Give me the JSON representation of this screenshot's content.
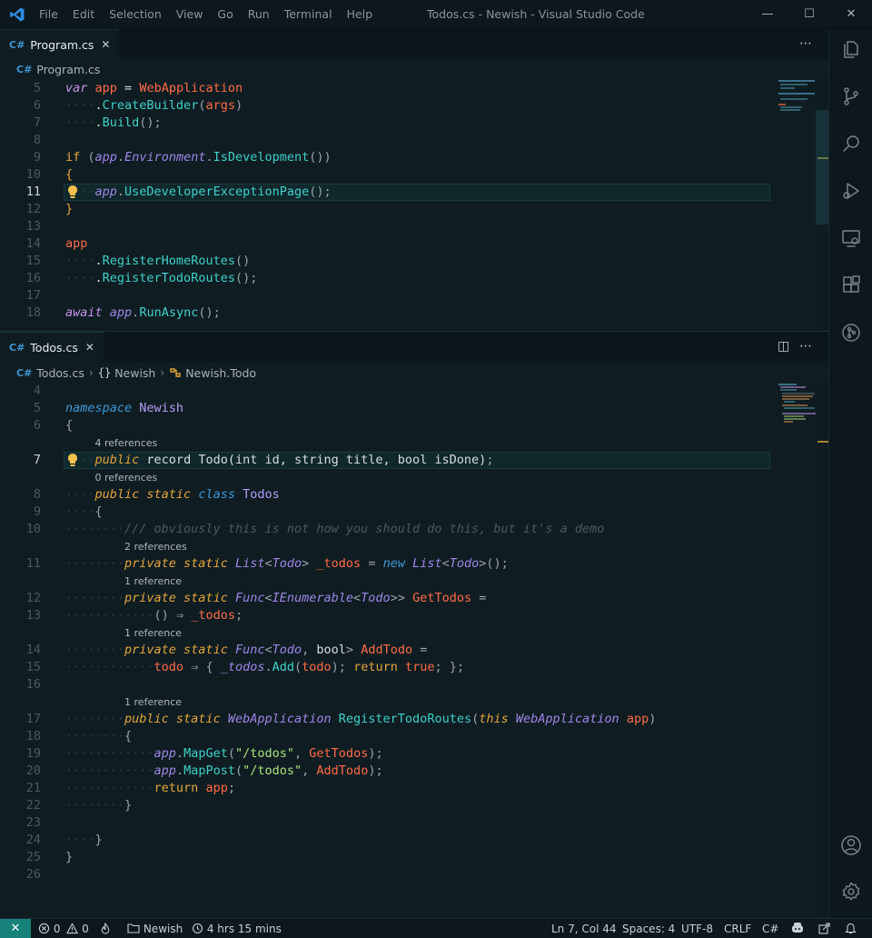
{
  "window": {
    "title": "Todos.cs - Newish - Visual Studio Code",
    "menu": [
      "File",
      "Edit",
      "Selection",
      "View",
      "Go",
      "Run",
      "Terminal",
      "Help"
    ]
  },
  "window_controls": {
    "minimize": "—",
    "maximize": "☐",
    "close": "✕"
  },
  "top_editor": {
    "tab_label": "Program.cs",
    "tab_lang_badge": "C#",
    "close_glyph": "✕",
    "more_actions_glyph": "⋯",
    "breadcrumb_file": "Program.cs",
    "active_line": 11,
    "code_lens": [],
    "lines": [
      {
        "n": "5",
        "seg": [
          [
            "var",
            "k"
          ],
          [
            " ",
            "pl"
          ],
          [
            "app",
            "v"
          ],
          [
            " = ",
            "pl"
          ],
          [
            "WebApplication",
            "v"
          ]
        ]
      },
      {
        "n": "6",
        "seg": [
          [
            "····",
            "ws"
          ],
          [
            ".",
            "pl"
          ],
          [
            "CreateBuilder",
            "m"
          ],
          [
            "(",
            "p"
          ],
          [
            "args",
            "v"
          ],
          [
            ")",
            "p"
          ]
        ]
      },
      {
        "n": "7",
        "seg": [
          [
            "····",
            "ws"
          ],
          [
            ".",
            "pl"
          ],
          [
            "Build",
            "m"
          ],
          [
            "();",
            "p"
          ]
        ]
      },
      {
        "n": "8",
        "seg": []
      },
      {
        "n": "9",
        "seg": [
          [
            "if",
            "ob"
          ],
          [
            " (",
            "p"
          ],
          [
            "app",
            "t"
          ],
          [
            ".",
            "p"
          ],
          [
            "Environment",
            "t"
          ],
          [
            ".",
            "p"
          ],
          [
            "IsDevelopment",
            "m"
          ],
          [
            "())",
            "p"
          ]
        ]
      },
      {
        "n": "10",
        "seg": [
          [
            "{",
            "ob"
          ]
        ]
      },
      {
        "n": "11",
        "seg": [
          [
            "····",
            "ws"
          ],
          [
            "app",
            "t"
          ],
          [
            ".",
            "p"
          ],
          [
            "UseDeveloperExceptionPage",
            "m"
          ],
          [
            "();",
            "p"
          ]
        ]
      },
      {
        "n": "12",
        "seg": [
          [
            "}",
            "ob"
          ]
        ]
      },
      {
        "n": "13",
        "seg": []
      },
      {
        "n": "14",
        "seg": [
          [
            "app",
            "v"
          ]
        ]
      },
      {
        "n": "15",
        "seg": [
          [
            "····",
            "ws"
          ],
          [
            ".",
            "pl"
          ],
          [
            "RegisterHomeRoutes",
            "m"
          ],
          [
            "()",
            "p"
          ]
        ]
      },
      {
        "n": "16",
        "seg": [
          [
            "····",
            "ws"
          ],
          [
            ".",
            "pl"
          ],
          [
            "RegisterTodoRoutes",
            "m"
          ],
          [
            "();",
            "p"
          ]
        ]
      },
      {
        "n": "17",
        "seg": []
      },
      {
        "n": "18",
        "seg": [
          [
            "await",
            "k"
          ],
          [
            " ",
            "pl"
          ],
          [
            "app",
            "t"
          ],
          [
            ".",
            "p"
          ],
          [
            "RunAsync",
            "m"
          ],
          [
            "();",
            "p"
          ]
        ]
      }
    ]
  },
  "bottom_editor": {
    "tab_label": "Todos.cs",
    "tab_lang_badge": "C#",
    "close_glyph": "✕",
    "split_glyph": "◫",
    "more_actions_glyph": "⋯",
    "breadcrumb": [
      "Todos.cs",
      "Newish",
      "Newish.Todo"
    ],
    "breadcrumb_separator": "›",
    "breadcrumb_namespace_glyph": "{}",
    "active_line": 7,
    "code_lens": [
      {
        "before_line": "7",
        "label": "4 references"
      },
      {
        "before_line": "8",
        "label": "0 references"
      },
      {
        "before_line": "11",
        "label": "2 references"
      },
      {
        "before_line": "12",
        "label": "1 reference"
      },
      {
        "before_line": "14",
        "label": "1 reference"
      },
      {
        "before_line": "17",
        "label": "1 reference"
      }
    ],
    "lines": [
      {
        "n": "4",
        "seg": []
      },
      {
        "n": "5",
        "seg": [
          [
            "namespace",
            "kb"
          ],
          [
            " ",
            "pl"
          ],
          [
            "Newish",
            "cls"
          ]
        ]
      },
      {
        "n": "6",
        "seg": [
          [
            "{",
            "p"
          ]
        ]
      },
      {
        "n": "7",
        "seg": [
          [
            "····",
            "ws"
          ],
          [
            "public",
            "kw"
          ],
          [
            " record ",
            "pl"
          ],
          [
            "Todo",
            "pl"
          ],
          [
            "(int id, string title, bool isDone)",
            "pl"
          ],
          [
            ";",
            "p"
          ]
        ]
      },
      {
        "n": "8",
        "seg": [
          [
            "····",
            "ws"
          ],
          [
            "public static",
            "kw"
          ],
          [
            " ",
            "pl"
          ],
          [
            "class",
            "kb"
          ],
          [
            " ",
            "pl"
          ],
          [
            "Todos",
            "cls"
          ]
        ]
      },
      {
        "n": "9",
        "seg": [
          [
            "····",
            "ws"
          ],
          [
            "{",
            "p"
          ]
        ]
      },
      {
        "n": "10",
        "seg": [
          [
            "········",
            "ws"
          ],
          [
            "/// obviously this is not how you should do this, but it's a demo",
            "cm"
          ]
        ]
      },
      {
        "n": "11",
        "seg": [
          [
            "········",
            "ws"
          ],
          [
            "private static",
            "kw"
          ],
          [
            " ",
            "pl"
          ],
          [
            "List",
            "t"
          ],
          [
            "<",
            "p"
          ],
          [
            "Todo",
            "t"
          ],
          [
            "> ",
            "p"
          ],
          [
            "_todos",
            "v"
          ],
          [
            " = ",
            "p"
          ],
          [
            "new",
            "kb"
          ],
          [
            " ",
            "pl"
          ],
          [
            "List",
            "t"
          ],
          [
            "<",
            "p"
          ],
          [
            "Todo",
            "t"
          ],
          [
            ">();",
            "p"
          ]
        ]
      },
      {
        "n": "12",
        "seg": [
          [
            "········",
            "ws"
          ],
          [
            "private static",
            "kw"
          ],
          [
            " ",
            "pl"
          ],
          [
            "Func",
            "t"
          ],
          [
            "<",
            "p"
          ],
          [
            "IEnumerable",
            "t"
          ],
          [
            "<",
            "p"
          ],
          [
            "Todo",
            "t"
          ],
          [
            ">> ",
            "p"
          ],
          [
            "GetTodos",
            "v"
          ],
          [
            " =",
            "p"
          ]
        ]
      },
      {
        "n": "13",
        "seg": [
          [
            "············",
            "ws"
          ],
          [
            "() ",
            "p"
          ],
          [
            "⇒",
            "p"
          ],
          [
            " ",
            "pl"
          ],
          [
            "_todos",
            "v"
          ],
          [
            ";",
            "p"
          ]
        ]
      },
      {
        "n": "14",
        "seg": [
          [
            "········",
            "ws"
          ],
          [
            "private static",
            "kw"
          ],
          [
            " ",
            "pl"
          ],
          [
            "Func",
            "t"
          ],
          [
            "<",
            "p"
          ],
          [
            "Todo",
            "t"
          ],
          [
            ", ",
            "p"
          ],
          [
            "bool",
            "pl"
          ],
          [
            "> ",
            "p"
          ],
          [
            "AddTodo",
            "v"
          ],
          [
            " =",
            "p"
          ]
        ]
      },
      {
        "n": "15",
        "seg": [
          [
            "············",
            "ws"
          ],
          [
            "todo",
            "v"
          ],
          [
            " ⇒ { ",
            "p"
          ],
          [
            "_todos",
            "t"
          ],
          [
            ".",
            "p"
          ],
          [
            "Add",
            "m"
          ],
          [
            "(",
            "p"
          ],
          [
            "todo",
            "v"
          ],
          [
            ");",
            "p"
          ],
          [
            " return ",
            "ob"
          ],
          [
            "true",
            "v"
          ],
          [
            ";",
            "p"
          ],
          [
            " };",
            "p"
          ]
        ]
      },
      {
        "n": "16",
        "seg": []
      },
      {
        "n": "17",
        "seg": [
          [
            "········",
            "ws"
          ],
          [
            "public static",
            "kw"
          ],
          [
            " ",
            "pl"
          ],
          [
            "WebApplication",
            "t"
          ],
          [
            " ",
            "pl"
          ],
          [
            "RegisterTodoRoutes",
            "m"
          ],
          [
            "(",
            "p"
          ],
          [
            "this",
            "kw"
          ],
          [
            " ",
            "pl"
          ],
          [
            "WebApplication",
            "t"
          ],
          [
            " ",
            "pl"
          ],
          [
            "app",
            "v"
          ],
          [
            ")",
            "p"
          ]
        ]
      },
      {
        "n": "18",
        "seg": [
          [
            "········",
            "ws"
          ],
          [
            "{",
            "p"
          ]
        ]
      },
      {
        "n": "19",
        "seg": [
          [
            "············",
            "ws"
          ],
          [
            "app",
            "t"
          ],
          [
            ".",
            "p"
          ],
          [
            "MapGet",
            "m"
          ],
          [
            "(",
            "p"
          ],
          [
            "\"/todos\"",
            "s"
          ],
          [
            ", ",
            "p"
          ],
          [
            "GetTodos",
            "v"
          ],
          [
            ");",
            "p"
          ]
        ]
      },
      {
        "n": "20",
        "seg": [
          [
            "············",
            "ws"
          ],
          [
            "app",
            "t"
          ],
          [
            ".",
            "p"
          ],
          [
            "MapPost",
            "m"
          ],
          [
            "(",
            "p"
          ],
          [
            "\"/todos\"",
            "s"
          ],
          [
            ", ",
            "p"
          ],
          [
            "AddTodo",
            "v"
          ],
          [
            ");",
            "p"
          ]
        ]
      },
      {
        "n": "21",
        "seg": [
          [
            "············",
            "ws"
          ],
          [
            "return",
            "ob"
          ],
          [
            " ",
            "pl"
          ],
          [
            "app",
            "v"
          ],
          [
            ";",
            "p"
          ]
        ]
      },
      {
        "n": "22",
        "seg": [
          [
            "········",
            "ws"
          ],
          [
            "}",
            "p"
          ]
        ]
      },
      {
        "n": "23",
        "seg": []
      },
      {
        "n": "24",
        "seg": [
          [
            "····",
            "ws"
          ],
          [
            "}",
            "p"
          ]
        ]
      },
      {
        "n": "25",
        "seg": [
          [
            "}",
            "p"
          ]
        ]
      },
      {
        "n": "26",
        "seg": []
      }
    ]
  },
  "statusbar": {
    "remote_glyph": "✕",
    "errors": "0",
    "warnings": "0",
    "folder": "Newish",
    "time": "4 hrs 15 mins",
    "position": "Ln 7, Col 44",
    "spaces": "Spaces: 4",
    "encoding": "UTF-8",
    "eol": "CRLF",
    "language": "C#"
  },
  "colors": {
    "background": "#0f1d22",
    "remote_indicator": "#16827a",
    "keyword": "#c792ea",
    "modifier": "#e5a43b",
    "method": "#3fd0c8",
    "variable": "#ff6b47",
    "string": "#a8e27e"
  }
}
